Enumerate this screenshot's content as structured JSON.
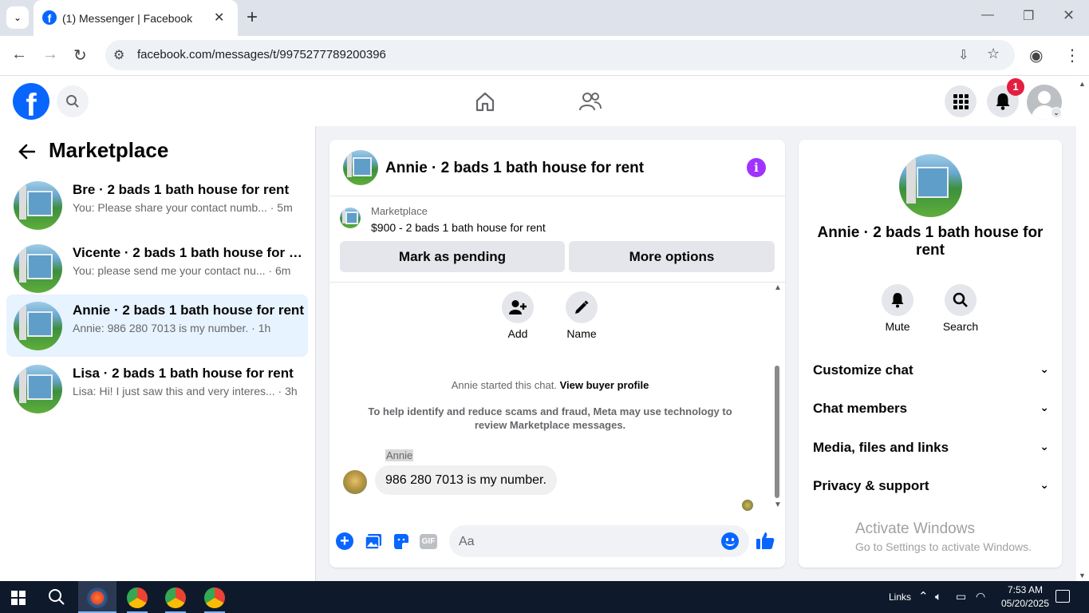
{
  "browser": {
    "tab_title": "(1) Messenger | Facebook",
    "url": "facebook.com/messages/t/9975277789200396",
    "tab_close": "✕",
    "new_tab": "+",
    "dropdown": "⌄"
  },
  "fb_header": {
    "logo": "f",
    "notification_count": "1"
  },
  "left_panel": {
    "title": "Marketplace",
    "conversations": [
      {
        "name": "Bre · 2 bads 1 bath house for rent",
        "preview": "You: Please share your contact numb... · 5m"
      },
      {
        "name": "Vicente · 2 bads 1 bath house for r...",
        "preview": "You: please send me your contact nu... · 6m"
      },
      {
        "name": "Annie · 2 bads 1 bath house for rent",
        "preview": "Annie: 986 280 7013 is my number. · 1h"
      },
      {
        "name": "Lisa · 2 bads 1 bath house for rent",
        "preview": "Lisa: Hi! I just saw this and very interes... · 3h"
      }
    ]
  },
  "chat": {
    "title": "Annie · 2 bads 1 bath house for rent",
    "listing_label": "Marketplace",
    "listing_price": "$900 - 2 bads 1 bath house for rent",
    "mark_pending": "Mark as pending",
    "more_options": "More options",
    "add_label": "Add",
    "name_label": "Name",
    "started_text": "Annie started this chat.",
    "view_profile": "View buyer profile",
    "notice": "To help identify and reduce scams and fraud, Meta may use technology to review Marketplace messages.",
    "sender": "Annie",
    "message": "986 280 7013 is my number.",
    "input_placeholder": "Aa"
  },
  "info": {
    "title": "Annie · 2 bads 1 bath house for rent",
    "mute": "Mute",
    "search": "Search",
    "sections": [
      "Customize chat",
      "Chat members",
      "Media, files and links",
      "Privacy & support"
    ]
  },
  "watermark": {
    "title": "Activate Windows",
    "subtitle": "Go to Settings to activate Windows."
  },
  "taskbar": {
    "links": "Links",
    "time": "7:53 AM",
    "date": "05/20/2025"
  },
  "colors": {
    "fb_blue": "#0866ff",
    "messenger_accent": "#a033ff",
    "active_bg": "#e7f3ff",
    "badge_red": "#e41e3f"
  }
}
